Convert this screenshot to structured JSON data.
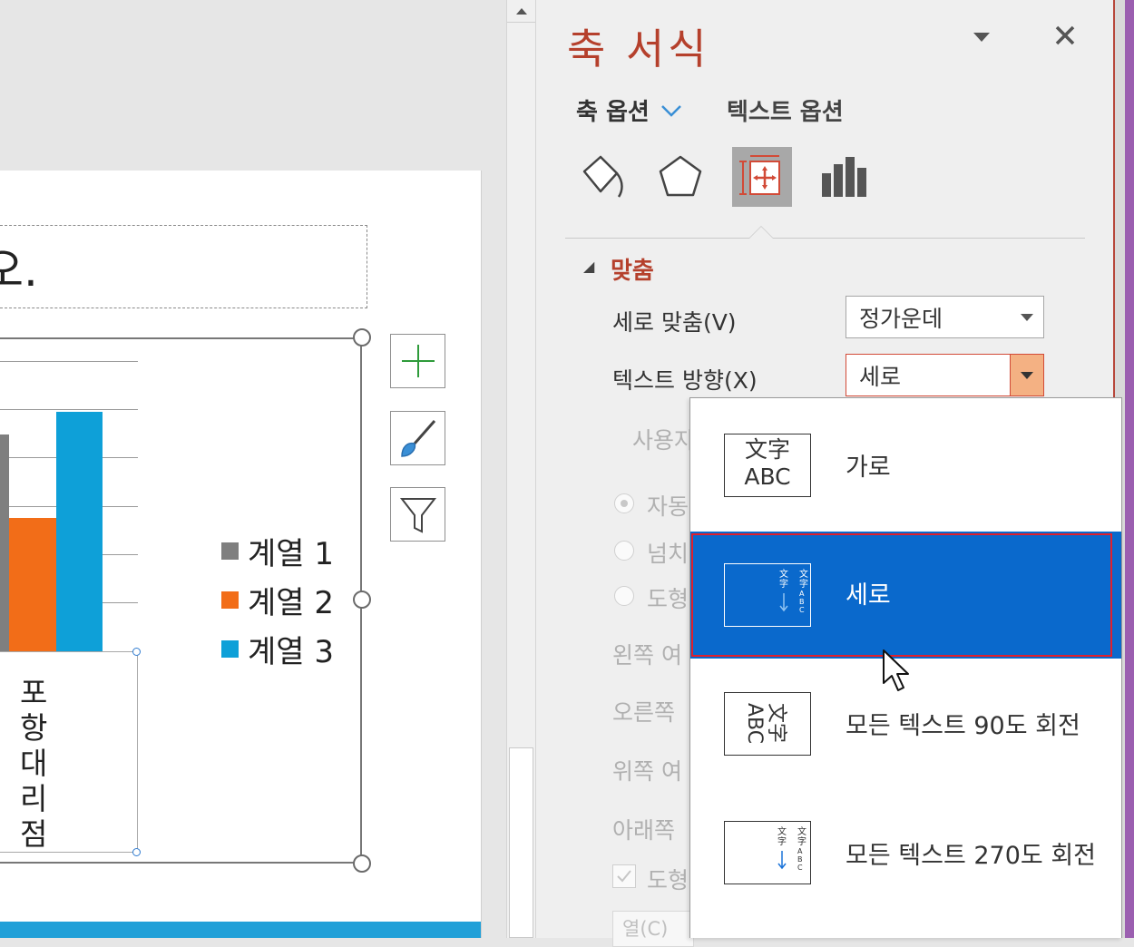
{
  "slide": {
    "title_fragment": "오.",
    "chart": {
      "category_label": "포항대리점",
      "legend": [
        {
          "label": "계열 1",
          "color": "#7f7f7f"
        },
        {
          "label": "계열 2",
          "color": "#f26d18"
        },
        {
          "label": "계열 3",
          "color": "#0ea0d8"
        }
      ],
      "side_buttons": [
        "plus-icon",
        "brush-icon",
        "filter-icon"
      ]
    }
  },
  "pane": {
    "title": "축 서식",
    "tab_axis": "축 옵션",
    "tab_text": "텍스트 옵션",
    "icons": [
      "fill-line-icon",
      "effects-pentagon-icon",
      "size-properties-icon",
      "axis-options-chart-icon"
    ],
    "section_title": "맞춤",
    "vertical_align_label": "세로 맞춤(V)",
    "vertical_align_value": "정가운데",
    "text_direction_label": "텍스트 방향(X)",
    "text_direction_value": "세로",
    "custom_angle_label": "사용자",
    "radio_autofit": "자동",
    "radio_overflow": "넘치",
    "radio_shape": "도형",
    "left_margin_label": "왼쪽 여",
    "right_margin_label": "오른쪽",
    "top_margin_label": "위쪽 여",
    "bottom_margin_label": "아래쪽",
    "wrap_checkbox_label": "도형",
    "bottom_field": "열(C)"
  },
  "dropdown": {
    "items": [
      {
        "label": "가로",
        "icon": "horizontal-text-icon",
        "selected": false
      },
      {
        "label": "세로",
        "icon": "vertical-text-icon",
        "selected": true
      },
      {
        "label": "모든 텍스트 90도 회전",
        "icon": "rotate-90-text-icon",
        "selected": false
      },
      {
        "label": "모든 텍스트 270도 회전",
        "icon": "rotate-270-text-icon",
        "selected": false
      }
    ],
    "icon_text_cjk": "文字",
    "icon_text_latin": "ABC"
  }
}
